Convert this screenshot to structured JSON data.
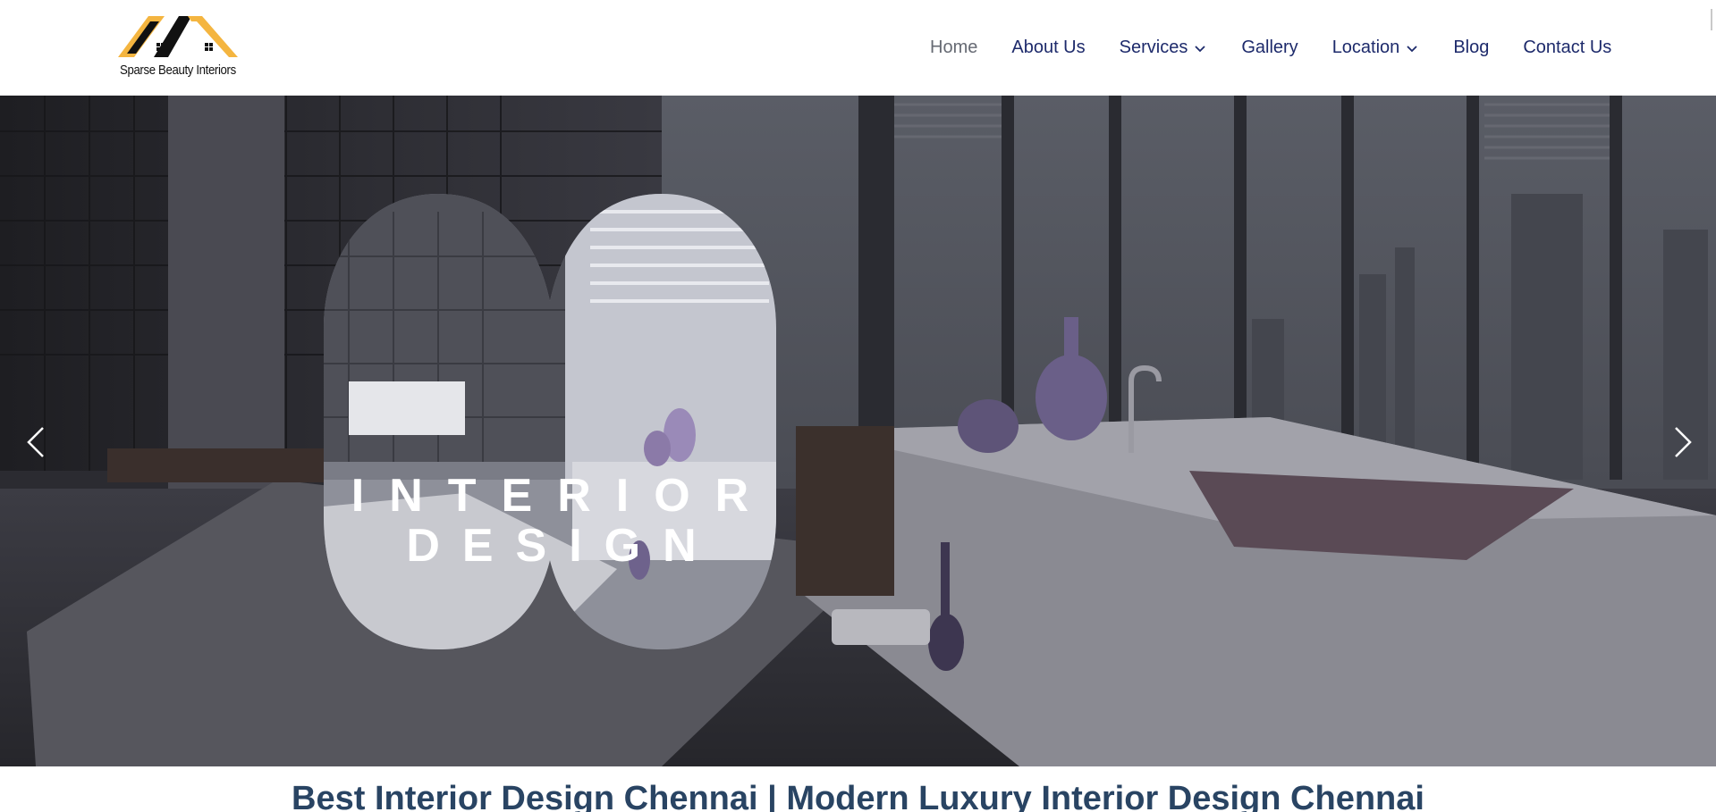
{
  "brand": {
    "name": "Sparse Beauty Interiors",
    "colors": {
      "roof_orange": "#F4B540",
      "roof_dark": "#111111"
    }
  },
  "nav": {
    "items": [
      {
        "label": "Home",
        "active": true,
        "has_dropdown": false
      },
      {
        "label": "About Us",
        "active": false,
        "has_dropdown": false
      },
      {
        "label": "Services",
        "active": false,
        "has_dropdown": true
      },
      {
        "label": "Gallery",
        "active": false,
        "has_dropdown": false
      },
      {
        "label": "Location",
        "active": false,
        "has_dropdown": true
      },
      {
        "label": "Blog",
        "active": false,
        "has_dropdown": false
      },
      {
        "label": "Contact Us",
        "active": false,
        "has_dropdown": false
      }
    ],
    "colors": {
      "link": "#1D2A6B",
      "active": "#666A73"
    }
  },
  "hero": {
    "title_line1": "INTERIOR",
    "title_line2": "DESIGN",
    "prev_icon": "chevron-left-icon",
    "next_icon": "chevron-right-icon"
  },
  "page": {
    "heading": "Best Interior Design Chennai | Modern Luxury Interior Design Chennai",
    "heading_color": "#294463"
  }
}
